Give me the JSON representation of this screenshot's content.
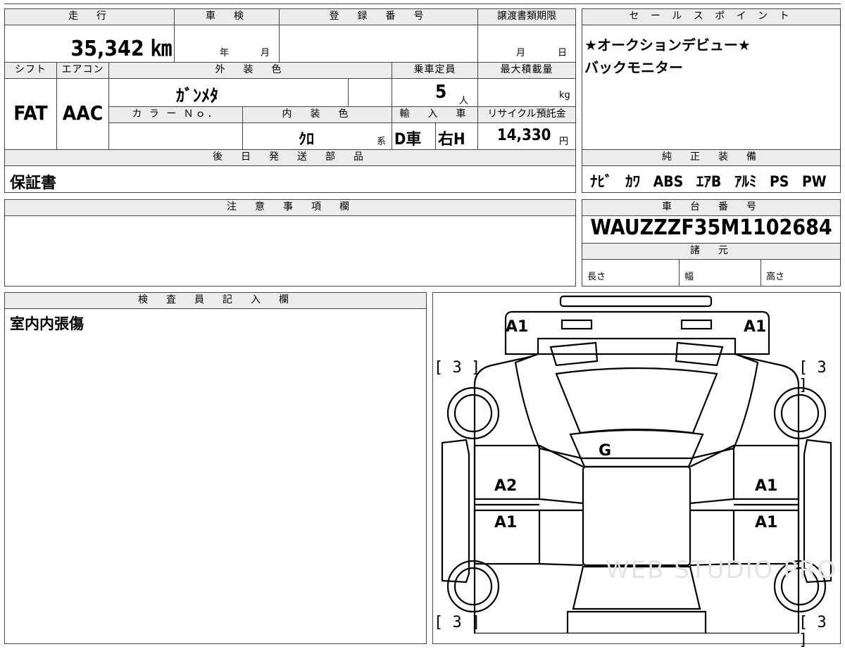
{
  "summary": {
    "mileage_header": "走　行",
    "mileage_value": "35,342 ㎞",
    "inspection_header": "車　検",
    "inspection_year": "年",
    "inspection_month": "月",
    "registration_header": "登　録　番　号",
    "transfer_header": "譲渡書類期限",
    "transfer_month": "月",
    "transfer_day": "日",
    "shift_header": "シフト",
    "ac_header": "エアコン",
    "exterior_header": "外　装　色",
    "capacity_header": "乗車定員",
    "maxload_header": "最大積載量",
    "shift_value": "FAT",
    "ac_value": "AAC",
    "exterior_value": "ｶﾞﾝﾒﾀ",
    "capacity_value": "5",
    "capacity_unit": "人",
    "maxload_unit": "kg",
    "color_no_header": "カ ラ ー Ｎｏ．",
    "interior_header": "内　装　色",
    "import_header": "輸　入　車",
    "recycle_header": "リサイクル預託金",
    "interior_value": "ｸﾛ",
    "interior_suffix": "系",
    "import_value": "D車",
    "steering_value": "右H",
    "recycle_value": "14,330",
    "recycle_unit": "円",
    "later_parts_header": "後　日　発　送　部　品",
    "later_parts_value": "保証書"
  },
  "sales_points": {
    "header": "セ ー ル ス ポ イ ン ト",
    "line1": "★オークションデビュー★",
    "line2": "バックモニター"
  },
  "equipment": {
    "header": "純　正　装　備",
    "items": [
      "ﾅﾋﾞ",
      "ｶﾜ",
      "ABS",
      "ｴｱB",
      "ｱﾙﾐ",
      "PS",
      "PW"
    ]
  },
  "notes": {
    "header": "注　意　事　項　欄"
  },
  "chassis": {
    "header": "車　台　番　号",
    "number": "WAUZZZF35M1102684",
    "specs_header": "諸　元",
    "length_label": "長さ",
    "width_label": "幅",
    "height_label": "高さ"
  },
  "inspector": {
    "header": "検　査　員　記　入　欄",
    "text": "室内内張傷"
  },
  "diagram": {
    "marks": {
      "front_left": "A1",
      "front_right": "A1",
      "tire_fl": "[ 3 ]",
      "tire_fr": "[ 3 ]",
      "windshield": "G",
      "door_fl": "A2",
      "door_fr": "A1",
      "door_rl": "A1",
      "door_rr": "A1",
      "tire_rl": "[ 3 ]",
      "tire_rr": "[ 3 ]"
    },
    "watermark": "WEB STUDIO PRO"
  }
}
